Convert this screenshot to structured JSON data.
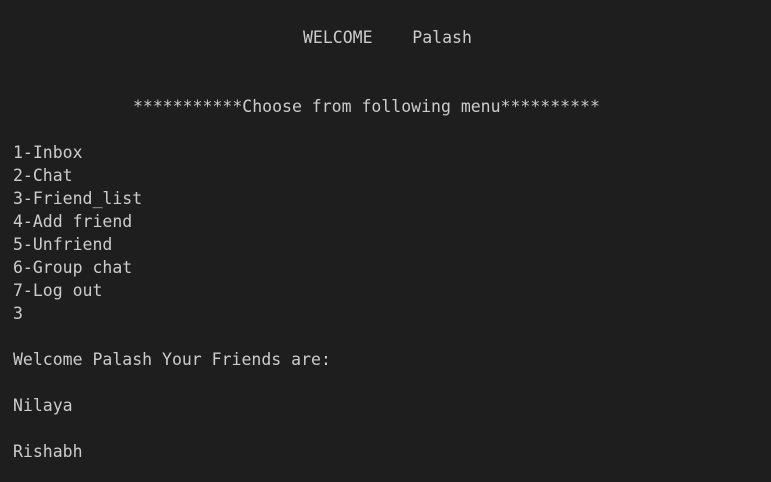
{
  "terminal": {
    "welcome_header": "WELCOME    Palash",
    "menu_banner": "***********Choose from following menu**********",
    "menu_items": [
      "1-Inbox",
      "2-Chat",
      "3-Friend_list",
      "4-Add friend",
      "5-Unfriend",
      "6-Group chat",
      "7-Log out"
    ],
    "user_input": "3",
    "friends_header": "Welcome Palash Your Friends are:",
    "friends": [
      "Nilaya",
      "Rishabh"
    ],
    "colors": {
      "background": "#1e1e1e",
      "text": "#cccccc"
    }
  }
}
